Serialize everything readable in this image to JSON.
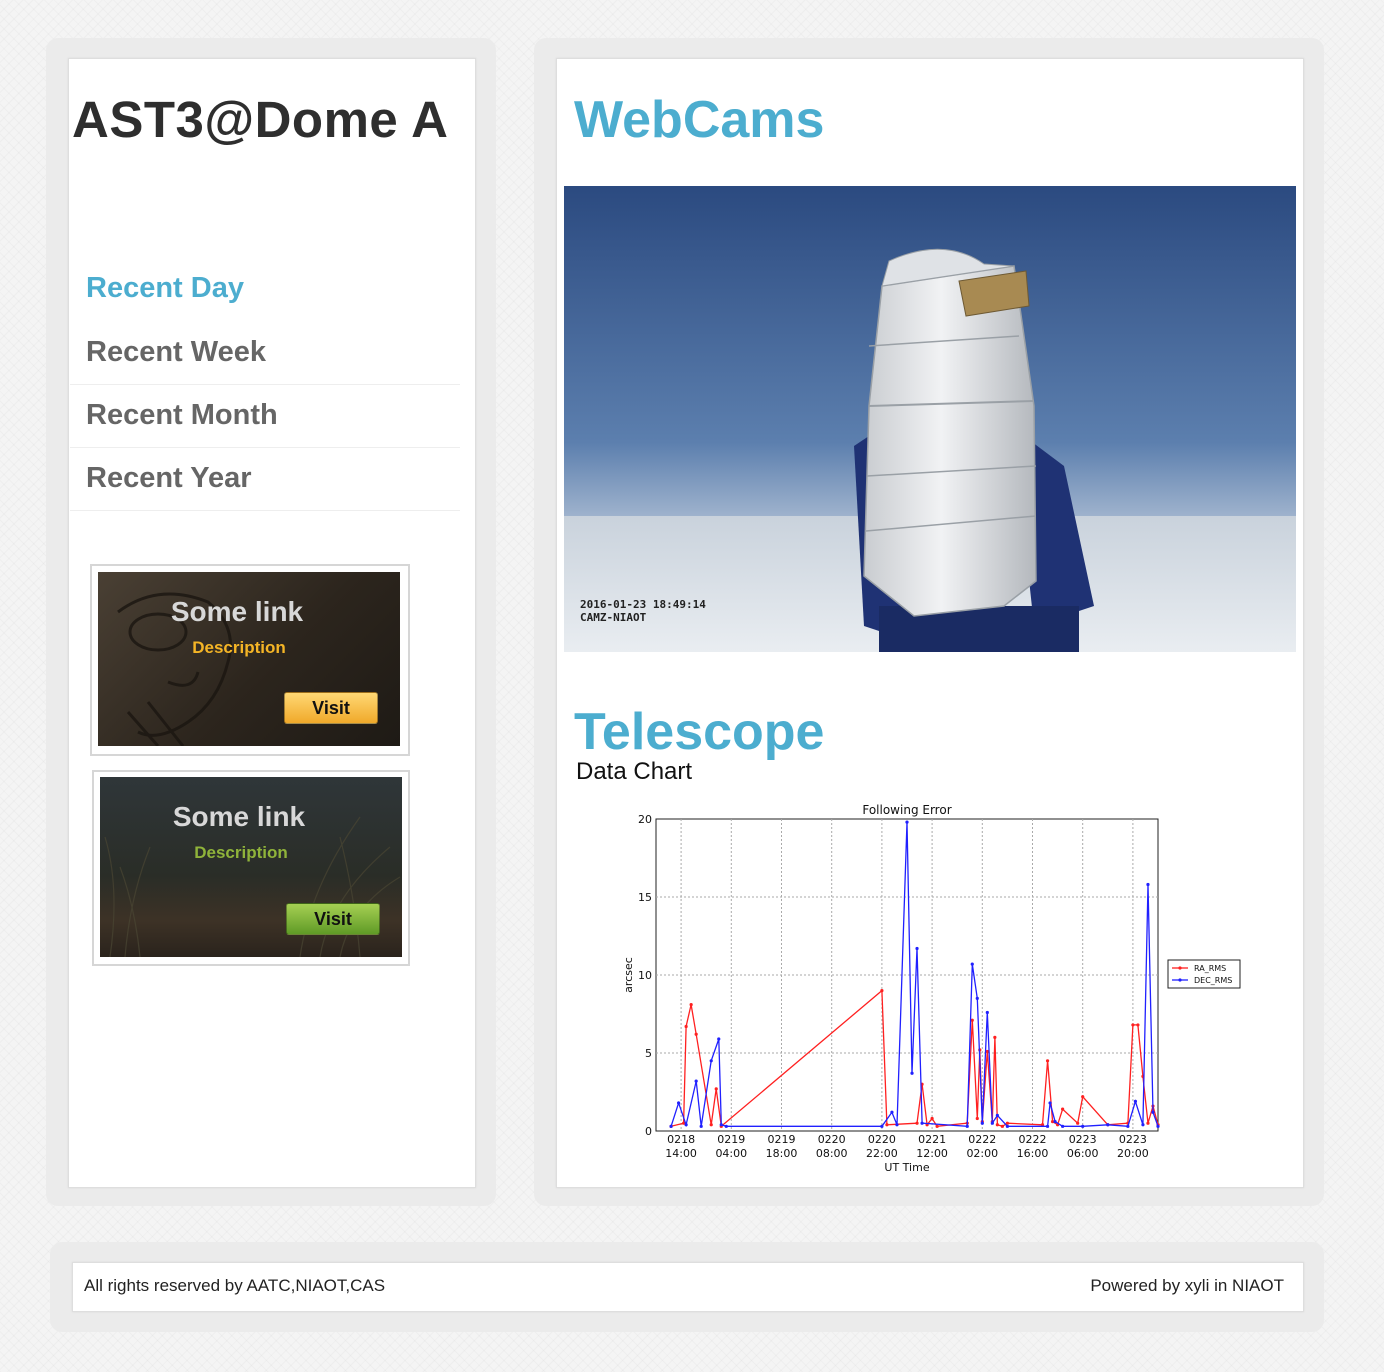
{
  "site": {
    "title": "AST3@Dome A"
  },
  "nav": {
    "items": [
      {
        "label": "Recent Day",
        "active": true
      },
      {
        "label": "Recent Week"
      },
      {
        "label": "Recent Month"
      },
      {
        "label": "Recent Year"
      }
    ]
  },
  "promos": [
    {
      "title": "Some link",
      "description": "Description",
      "button": "Visit",
      "accent": "#f5b526"
    },
    {
      "title": "Some link",
      "description": "Description",
      "button": "Visit",
      "accent": "#8fb33a"
    }
  ],
  "webcams": {
    "title": "WebCams",
    "timestamp": "2016-01-23 18:49:14\nCAMZ-NIAOT"
  },
  "telescope": {
    "title": "Telescope",
    "subtitle": "Data Chart"
  },
  "chart_data": {
    "type": "line",
    "title": "Following Error",
    "xlabel": "UT Time",
    "ylabel": "arcsec",
    "ylim": [
      0,
      20
    ],
    "yticks": [
      0,
      5,
      10,
      15,
      20
    ],
    "xticks": [
      [
        "0218",
        "14:00"
      ],
      [
        "0219",
        "04:00"
      ],
      [
        "0219",
        "18:00"
      ],
      [
        "0220",
        "08:00"
      ],
      [
        "0220",
        "22:00"
      ],
      [
        "0221",
        "12:00"
      ],
      [
        "0222",
        "02:00"
      ],
      [
        "0222",
        "16:00"
      ],
      [
        "0223",
        "06:00"
      ],
      [
        "0223",
        "20:00"
      ]
    ],
    "grid": true,
    "legend": "right",
    "series": [
      {
        "name": "RA_RMS",
        "color": "#ff2020",
        "x": [
          0.3,
          0.55,
          0.6,
          0.7,
          0.8,
          1.1,
          1.2,
          1.3,
          4.5,
          4.6,
          5.2,
          5.3,
          5.4,
          5.5,
          5.6,
          6.2,
          6.3,
          6.4,
          6.45,
          6.5,
          6.6,
          6.7,
          6.75,
          6.8,
          6.9,
          7.0,
          7.7,
          7.8,
          7.9,
          8.0,
          8.1,
          8.4,
          8.5,
          9.0,
          9.4,
          9.5,
          9.6,
          9.7,
          9.8,
          9.9,
          10.0
        ],
        "values": [
          0.3,
          0.5,
          6.7,
          8.1,
          6.2,
          0.4,
          2.7,
          0.3,
          9.0,
          0.4,
          0.5,
          3.0,
          0.4,
          0.8,
          0.3,
          0.5,
          7.1,
          0.8,
          5.2,
          0.6,
          5.1,
          0.6,
          6.0,
          0.4,
          0.3,
          0.5,
          0.4,
          4.5,
          0.6,
          0.4,
          1.4,
          0.5,
          2.2,
          0.4,
          0.5,
          6.8,
          6.8,
          3.5,
          0.5,
          1.6,
          0.4
        ]
      },
      {
        "name": "DEC_RMS",
        "color": "#2020ff",
        "x": [
          0.3,
          0.45,
          0.6,
          0.8,
          0.9,
          1.1,
          1.25,
          1.3,
          1.4,
          4.5,
          4.7,
          4.8,
          5.0,
          5.1,
          5.2,
          5.3,
          6.2,
          6.3,
          6.4,
          6.5,
          6.6,
          6.7,
          6.8,
          7.0,
          7.8,
          7.85,
          7.95,
          8.1,
          8.5,
          9.0,
          9.4,
          9.55,
          9.7,
          9.8,
          9.9,
          10.0
        ],
        "values": [
          0.3,
          1.8,
          0.4,
          3.2,
          0.3,
          4.5,
          5.9,
          0.4,
          0.3,
          0.3,
          1.2,
          0.4,
          19.8,
          3.7,
          11.7,
          0.5,
          0.3,
          10.7,
          8.5,
          0.5,
          7.6,
          0.5,
          1.0,
          0.3,
          0.3,
          1.8,
          0.6,
          0.3,
          0.3,
          0.4,
          0.3,
          1.9,
          0.4,
          15.8,
          1.2,
          0.3
        ]
      }
    ]
  },
  "footer": {
    "left": "All rights reserved by AATC,NIAOT,CAS",
    "right": "Powered by xyli in NIAOT"
  }
}
